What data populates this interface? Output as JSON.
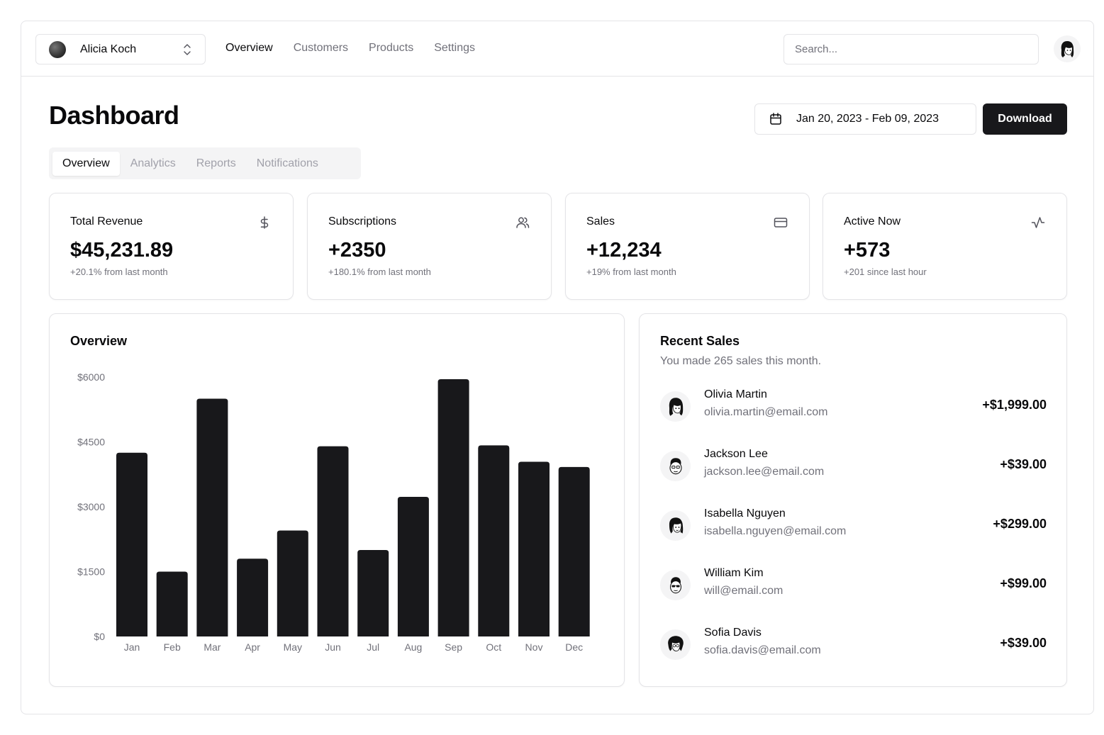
{
  "header": {
    "team_name": "Alicia Koch",
    "nav": [
      "Overview",
      "Customers",
      "Products",
      "Settings"
    ],
    "search_placeholder": "Search..."
  },
  "page": {
    "title": "Dashboard",
    "date_range": "Jan 20, 2023 - Feb 09, 2023",
    "download_label": "Download",
    "tabs": [
      "Overview",
      "Analytics",
      "Reports",
      "Notifications"
    ]
  },
  "stats": [
    {
      "title": "Total Revenue",
      "value": "$45,231.89",
      "sub": "+20.1% from last month",
      "icon": "dollar-icon"
    },
    {
      "title": "Subscriptions",
      "value": "+2350",
      "sub": "+180.1% from last month",
      "icon": "users-icon"
    },
    {
      "title": "Sales",
      "value": "+12,234",
      "sub": "+19% from last month",
      "icon": "credit-card-icon"
    },
    {
      "title": "Active Now",
      "value": "+573",
      "sub": "+201 since last hour",
      "icon": "activity-icon"
    }
  ],
  "overview": {
    "title": "Overview"
  },
  "chart_data": {
    "type": "bar",
    "title": "Overview",
    "categories": [
      "Jan",
      "Feb",
      "Mar",
      "Apr",
      "May",
      "Jun",
      "Jul",
      "Aug",
      "Sep",
      "Oct",
      "Nov",
      "Dec"
    ],
    "values": [
      4250,
      1500,
      5500,
      1800,
      2450,
      4400,
      2000,
      3230,
      5950,
      4420,
      4040,
      3920
    ],
    "y_ticks": [
      "$0",
      "$1500",
      "$3000",
      "$4500",
      "$6000"
    ],
    "ylim": [
      0,
      6000
    ],
    "bar_color": "#18181b",
    "grid": false,
    "xlabel": "",
    "ylabel": ""
  },
  "recent_sales": {
    "title": "Recent Sales",
    "subtitle": "You made 265 sales this month.",
    "items": [
      {
        "name": "Olivia Martin",
        "email": "olivia.martin@email.com",
        "amount": "+$1,999.00"
      },
      {
        "name": "Jackson Lee",
        "email": "jackson.lee@email.com",
        "amount": "+$39.00"
      },
      {
        "name": "Isabella Nguyen",
        "email": "isabella.nguyen@email.com",
        "amount": "+$299.00"
      },
      {
        "name": "William Kim",
        "email": "will@email.com",
        "amount": "+$99.00"
      },
      {
        "name": "Sofia Davis",
        "email": "sofia.davis@email.com",
        "amount": "+$39.00"
      }
    ]
  },
  "colors": {
    "primary": "#18181b",
    "muted": "#71717a",
    "border": "#e4e4e7",
    "tab_bg": "#f4f4f5"
  }
}
